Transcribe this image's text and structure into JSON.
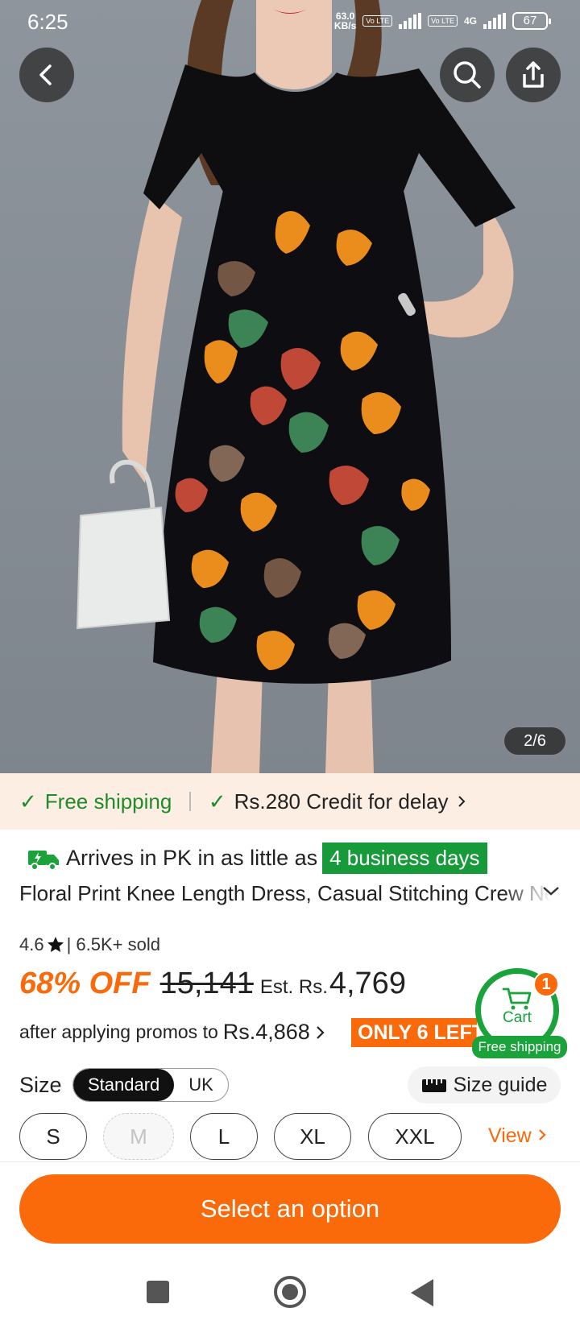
{
  "status_bar": {
    "time": "6:25",
    "net_speed_value": "63.0",
    "net_speed_unit": "KB/s",
    "volte1": "Vo LTE",
    "volte2": "Vo LTE",
    "network": "4G",
    "battery": "67"
  },
  "gallery": {
    "counter": "2/6",
    "current": 2,
    "total": 6
  },
  "shipping_strip": {
    "free_shipping": "Free shipping",
    "credit": "Rs.280 Credit for delay"
  },
  "delivery": {
    "text": "Arrives in PK in as little as",
    "badge": "4 business days"
  },
  "product": {
    "title": "Floral Print Knee Length Dress, Casual Stitching Crew Neck Short Sleeve Dress",
    "rating": "4.6",
    "sold": "| 6.5K+ sold",
    "discount": "68% OFF",
    "original_price": "15,141",
    "est_label": "Est. Rs.",
    "est_price": "4,769",
    "promo_text": "after applying promos to",
    "promo_price": "Rs.4,868",
    "stock_badge": "ONLY 6 LEFT"
  },
  "cart": {
    "label": "Cart",
    "count": "1",
    "free_shipping": "Free shipping"
  },
  "size": {
    "label": "Size",
    "systems": [
      "Standard",
      "UK"
    ],
    "selected_system": "Standard",
    "guide": "Size guide",
    "options": [
      "S",
      "M",
      "L",
      "XL",
      "XXL"
    ],
    "unavailable": [
      "M"
    ],
    "view": "View"
  },
  "cta": {
    "label": "Select an option"
  },
  "colors": {
    "accent": "#fa6a0a",
    "success": "#1aa33a",
    "strip_bg": "#fdeee3"
  }
}
